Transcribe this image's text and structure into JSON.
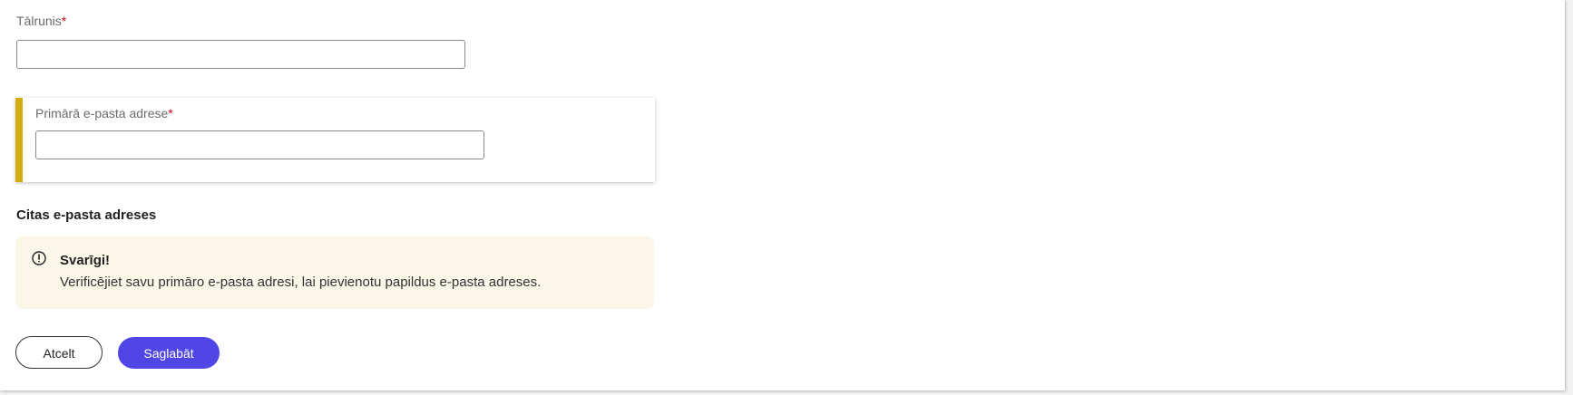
{
  "phone": {
    "label": "Tālrunis",
    "required_mark": "*",
    "value": "",
    "placeholder": ""
  },
  "primary_email": {
    "label": "Primārā e-pasta adrese",
    "required_mark": "*",
    "value": "",
    "placeholder": ""
  },
  "other_emails": {
    "title": "Citas e-pasta adreses"
  },
  "notice": {
    "icon": "alert-circle-icon",
    "title": "Svarīgi!",
    "text": "Verificējiet savu primāro e-pasta adresi, lai pievienotu papildus e-pasta adreses."
  },
  "actions": {
    "cancel_label": "Atcelt",
    "save_label": "Saglabāt"
  },
  "colors": {
    "accent": "#4f46e5",
    "highlight_bar": "#d4ac0d",
    "notice_bg": "#faf7e8",
    "required": "#d0021b"
  }
}
